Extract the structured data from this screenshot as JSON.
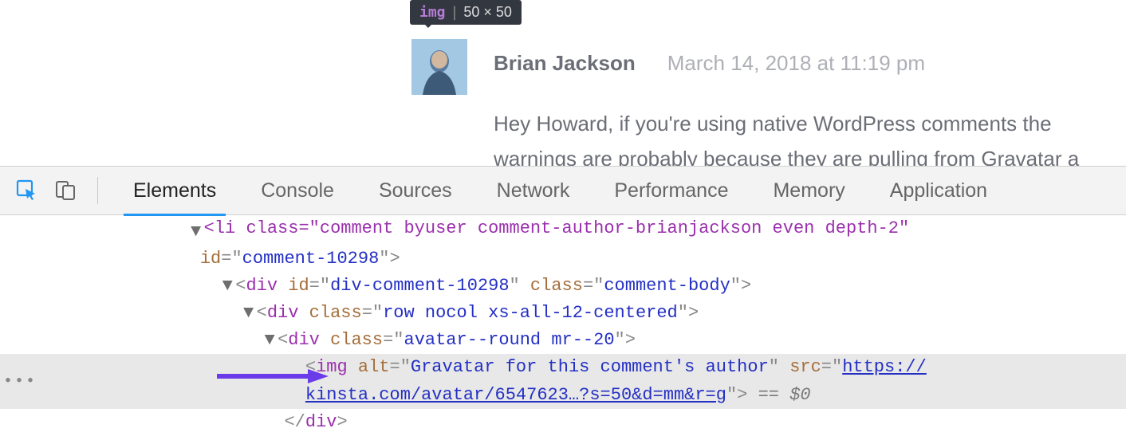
{
  "tooltip": {
    "tag": "img",
    "sep": "|",
    "dims": "50 × 50"
  },
  "comment": {
    "author": "Brian Jackson",
    "date": "March 14, 2018 at 11:19 pm",
    "body": "Hey Howard, if you're using native WordPress comments the warnings are probably because they are pulling from Gravatar a"
  },
  "devtools": {
    "tabs": {
      "elements": "Elements",
      "console": "Console",
      "sources": "Sources",
      "network": "Network",
      "performance": "Performance",
      "memory": "Memory",
      "application": "Application"
    }
  },
  "dom": {
    "line0_clipped": "<li class=\"comment byuser comment-author-brianjackson even depth-2\"",
    "line1": {
      "attr": "id",
      "val": "comment-10298"
    },
    "line2": {
      "tag": "div",
      "attr1": "id",
      "val1": "div-comment-10298",
      "attr2": "class",
      "val2": "comment-body"
    },
    "line3": {
      "tag": "div",
      "attr": "class",
      "val": "row nocol xs-all-12-centered"
    },
    "line4": {
      "tag": "div",
      "attr": "class",
      "val": "avatar--round mr--20"
    },
    "line5": {
      "tag": "img",
      "attr1": "alt",
      "val1": "Gravatar for this comment's author",
      "attr2": "src",
      "link1": "https://",
      "link2": "kinsta.com/avatar/6547623…?s=50&d=mm&r=g",
      "eq": " == ",
      "dollar": "$0"
    },
    "line6": "</div>"
  }
}
